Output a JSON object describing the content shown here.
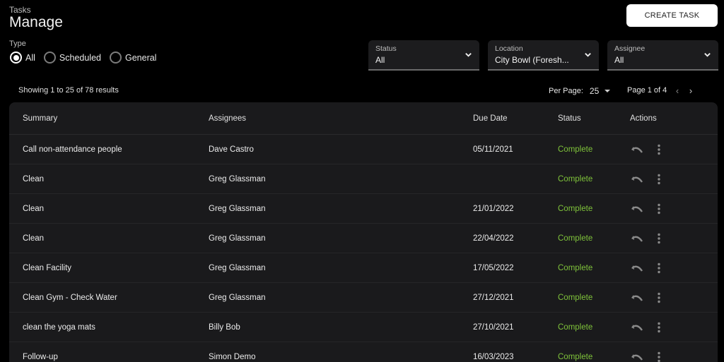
{
  "header": {
    "breadcrumb": "Tasks",
    "title": "Manage",
    "create_button": "CREATE TASK"
  },
  "type_filter": {
    "label": "Type",
    "options": [
      {
        "label": "All",
        "checked": true
      },
      {
        "label": "Scheduled",
        "checked": false
      },
      {
        "label": "General",
        "checked": false
      }
    ]
  },
  "filters": [
    {
      "label": "Status",
      "value": "All"
    },
    {
      "label": "Location",
      "value": "City Bowl (Foresh..."
    },
    {
      "label": "Assignee",
      "value": "All"
    }
  ],
  "pagination": {
    "results_text": "Showing 1 to 25 of 78 results",
    "per_page_label": "Per Page:",
    "per_page_value": "25",
    "page_text": "Page 1 of 4",
    "prev": "‹",
    "next": "›"
  },
  "table": {
    "columns": [
      "Summary",
      "Assignees",
      "Due Date",
      "Status",
      "Actions"
    ],
    "status_color": "#7fc33a",
    "rows": [
      {
        "summary": "Call non-attendance people",
        "assignee": "Dave Castro",
        "due": "05/11/2021",
        "status": "Complete"
      },
      {
        "summary": "Clean",
        "assignee": "Greg Glassman",
        "due": "",
        "status": "Complete"
      },
      {
        "summary": "Clean",
        "assignee": "Greg Glassman",
        "due": "21/01/2022",
        "status": "Complete"
      },
      {
        "summary": "Clean",
        "assignee": "Greg Glassman",
        "due": "22/04/2022",
        "status": "Complete"
      },
      {
        "summary": "Clean Facility",
        "assignee": "Greg Glassman",
        "due": "17/05/2022",
        "status": "Complete"
      },
      {
        "summary": "Clean Gym - Check Water",
        "assignee": "Greg Glassman",
        "due": "27/12/2021",
        "status": "Complete"
      },
      {
        "summary": "clean the yoga mats",
        "assignee": "Billy Bob",
        "due": "27/10/2021",
        "status": "Complete"
      },
      {
        "summary": "Follow-up",
        "assignee": "Simon Demo",
        "due": "16/03/2023",
        "status": "Complete"
      }
    ]
  }
}
